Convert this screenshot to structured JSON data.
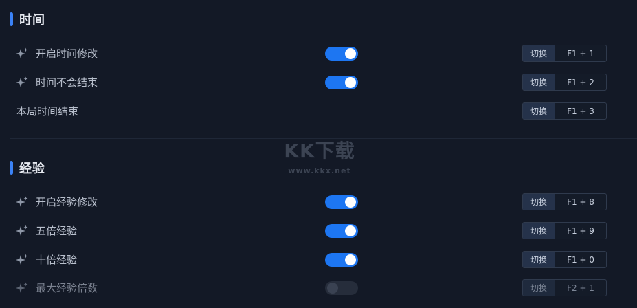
{
  "sections": [
    {
      "title": "时间",
      "rows": [
        {
          "label": "开启时间修改",
          "sparkle": true,
          "toggle": "on",
          "hotkey_switch": "切换",
          "hotkey": "F1 + 1"
        },
        {
          "label": "时间不会结束",
          "sparkle": true,
          "toggle": "on",
          "hotkey_switch": "切换",
          "hotkey": "F1 + 2"
        },
        {
          "label": "本局时间结束",
          "sparkle": false,
          "toggle": null,
          "hotkey_switch": "切换",
          "hotkey": "F1 + 3"
        }
      ]
    },
    {
      "title": "经验",
      "rows": [
        {
          "label": "开启经验修改",
          "sparkle": true,
          "toggle": "on",
          "hotkey_switch": "切换",
          "hotkey": "F1 + 8"
        },
        {
          "label": "五倍经验",
          "sparkle": true,
          "toggle": "on",
          "hotkey_switch": "切换",
          "hotkey": "F1 + 9"
        },
        {
          "label": "十倍经验",
          "sparkle": true,
          "toggle": "on",
          "hotkey_switch": "切换",
          "hotkey": "F1 + 0"
        },
        {
          "label": "最大经验倍数",
          "sparkle": true,
          "toggle": "off",
          "hotkey_switch": "切换",
          "hotkey": "F2 + 1"
        }
      ]
    }
  ],
  "watermark": {
    "logo": "KK下载",
    "url": "www.kkx.net"
  },
  "colors": {
    "background": "#131926",
    "accent": "#3b82f6",
    "toggle_on": "#1d76f2",
    "toggle_off": "#262d3b"
  }
}
